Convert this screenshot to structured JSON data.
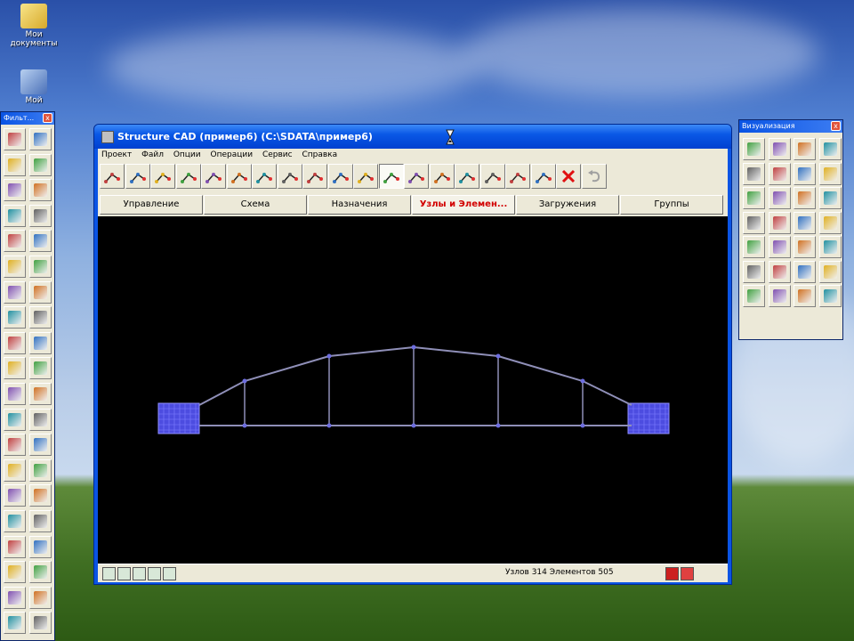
{
  "desktop": {
    "icons": [
      {
        "label": "Мои документы",
        "icon": "my-documents-icon"
      },
      {
        "label": "Мой",
        "icon": "my-computer-icon"
      }
    ]
  },
  "left_palette": {
    "title": "Фильт..."
  },
  "right_palette": {
    "title": "Визуализация"
  },
  "window": {
    "title": "Structure CAD (пример6) (C:\\SDATA\\пример6)",
    "menu": [
      "Проект",
      "Файл",
      "Опции",
      "Операции",
      "Сервис",
      "Справка"
    ],
    "tabs": [
      {
        "label": "Управление",
        "active": false
      },
      {
        "label": "Схема",
        "active": false
      },
      {
        "label": "Назначения",
        "active": false
      },
      {
        "label": "Узлы и Элемен...",
        "active": true
      },
      {
        "label": "Загружения",
        "active": false
      },
      {
        "label": "Группы",
        "active": false
      }
    ],
    "status": "Узлов 314 Элементов 505"
  },
  "colors": {
    "canvas": "#000000",
    "structure_line": "#8f8fb8",
    "node": "#6e6ee0",
    "support": "#4c4ce0",
    "active_tab_text": "#d20000"
  }
}
